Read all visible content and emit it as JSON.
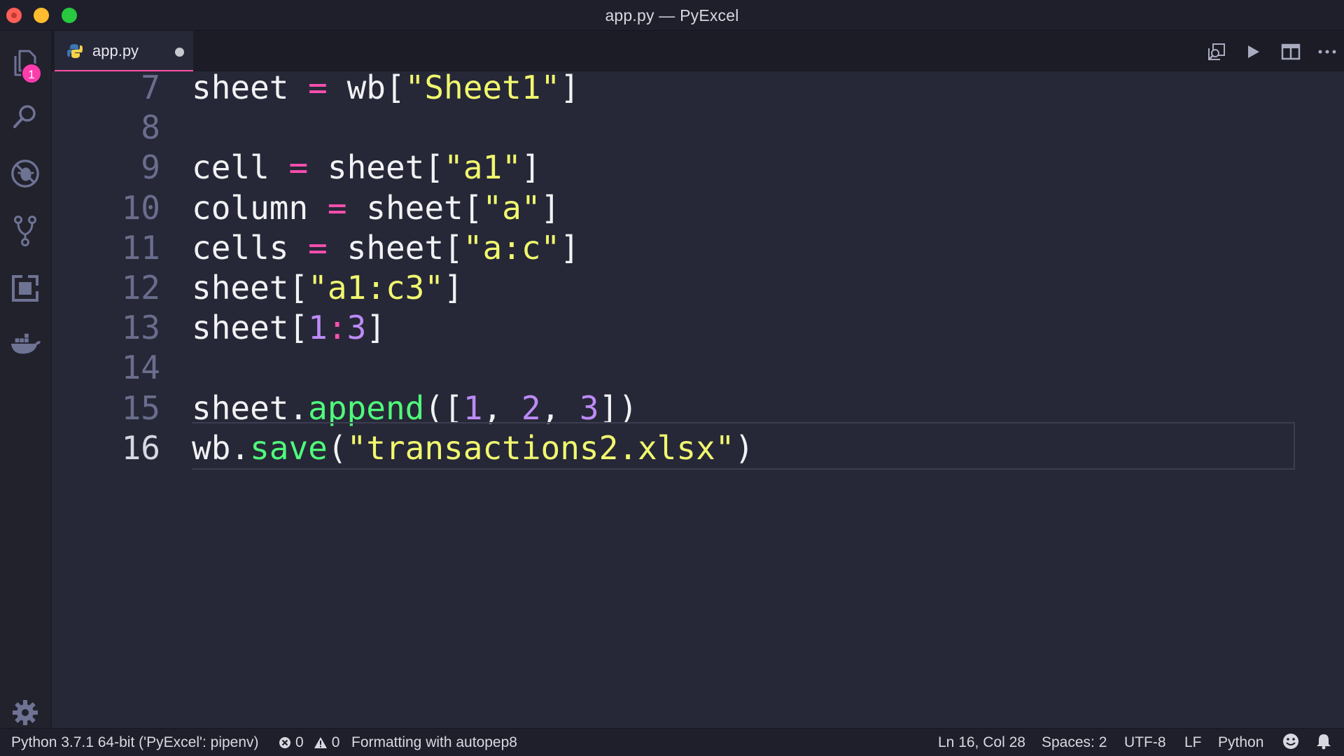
{
  "window": {
    "title": "app.py — PyExcel"
  },
  "activity_bar": {
    "explorer_badge": "1",
    "icons": [
      "files-icon",
      "search-icon",
      "no-bug-icon",
      "source-control-icon",
      "extensions-icon",
      "docker-icon",
      "settings-gear-icon"
    ]
  },
  "tabs": [
    {
      "label": "app.py",
      "modified": true
    }
  ],
  "editor": {
    "active_line": 16,
    "lines": [
      {
        "number": "7",
        "tokens": [
          [
            "plain",
            "sheet "
          ],
          [
            "op",
            "="
          ],
          [
            "plain",
            " wb["
          ],
          [
            "str",
            "\"Sheet1\""
          ],
          [
            "plain",
            "]"
          ]
        ]
      },
      {
        "number": "8",
        "tokens": []
      },
      {
        "number": "9",
        "tokens": [
          [
            "plain",
            "cell "
          ],
          [
            "op",
            "="
          ],
          [
            "plain",
            " sheet["
          ],
          [
            "str",
            "\"a1\""
          ],
          [
            "plain",
            "]"
          ]
        ]
      },
      {
        "number": "10",
        "tokens": [
          [
            "plain",
            "column "
          ],
          [
            "op",
            "="
          ],
          [
            "plain",
            " sheet["
          ],
          [
            "str",
            "\"a\""
          ],
          [
            "plain",
            "]"
          ]
        ]
      },
      {
        "number": "11",
        "tokens": [
          [
            "plain",
            "cells "
          ],
          [
            "op",
            "="
          ],
          [
            "plain",
            " sheet["
          ],
          [
            "str",
            "\"a:c\""
          ],
          [
            "plain",
            "]"
          ]
        ]
      },
      {
        "number": "12",
        "tokens": [
          [
            "plain",
            "sheet["
          ],
          [
            "str",
            "\"a1:c3\""
          ],
          [
            "plain",
            "]"
          ]
        ]
      },
      {
        "number": "13",
        "tokens": [
          [
            "plain",
            "sheet["
          ],
          [
            "num",
            "1"
          ],
          [
            "op",
            ":"
          ],
          [
            "num",
            "3"
          ],
          [
            "plain",
            "]"
          ]
        ]
      },
      {
        "number": "14",
        "tokens": []
      },
      {
        "number": "15",
        "tokens": [
          [
            "plain",
            "sheet."
          ],
          [
            "fn",
            "append"
          ],
          [
            "plain",
            "(["
          ],
          [
            "num",
            "1"
          ],
          [
            "plain",
            ", "
          ],
          [
            "num",
            "2"
          ],
          [
            "plain",
            ", "
          ],
          [
            "num",
            "3"
          ],
          [
            "plain",
            "])"
          ]
        ]
      },
      {
        "number": "16",
        "tokens": [
          [
            "plain",
            "wb."
          ],
          [
            "fn",
            "save"
          ],
          [
            "plain",
            "("
          ],
          [
            "str",
            "\"transactions2.xlsx\""
          ],
          [
            "plain",
            ")"
          ]
        ]
      }
    ]
  },
  "status_bar": {
    "interpreter": "Python 3.7.1 64-bit ('PyExcel': pipenv)",
    "errors": "0",
    "warnings": "0",
    "message": "Formatting with autopep8",
    "cursor": "Ln 16, Col 28",
    "indent": "Spaces: 2",
    "encoding": "UTF-8",
    "eol": "LF",
    "language": "Python"
  },
  "colors": {
    "accent_pink": "#ff4fb0",
    "string": "#f1f86e",
    "number": "#bd8bf7",
    "function": "#50fa7b",
    "background": "#262837"
  }
}
